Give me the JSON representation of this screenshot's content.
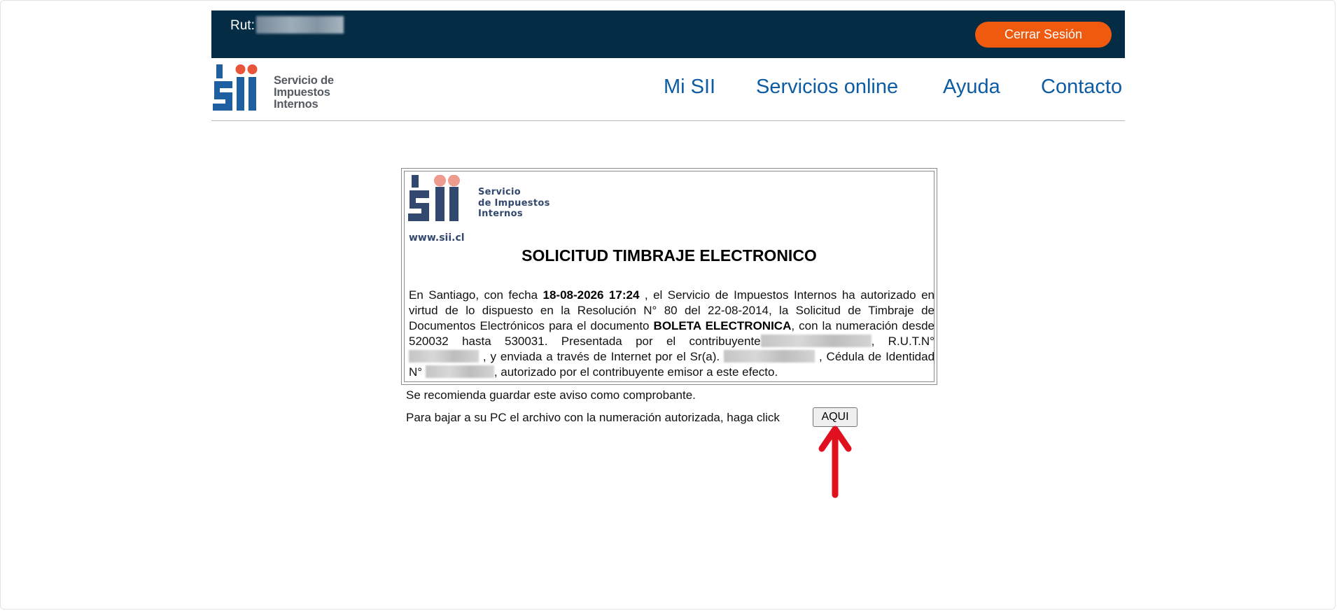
{
  "topbar": {
    "rut_label": "Rut:",
    "logout_label": "Cerrar Sesión"
  },
  "header": {
    "logo_lines": [
      "Servicio de",
      "Impuestos",
      "Internos"
    ],
    "nav": [
      {
        "label": "Mi SII"
      },
      {
        "label": "Servicios online"
      },
      {
        "label": "Ayuda"
      },
      {
        "label": "Contacto"
      }
    ]
  },
  "certificate": {
    "logo_lines": [
      "Servicio",
      "de Impuestos",
      "Internos"
    ],
    "url": "www.sii.cl",
    "title": "SOLICITUD TIMBRAJE ELECTRONICO",
    "body": {
      "p1": "En Santiago, con fecha",
      "fecha": "18-08-2026 17:24",
      "p2": ", el Servicio de Impuestos Internos ha autorizado en virtud de lo dispuesto en la Resolución N° 80 del 22-08-2014, la Solicitud de Timbraje de Documentos Electrónicos para el documento",
      "documento": "BOLETA ELECTRONICA",
      "p3": ", con la numeración desde 520032 hasta 530031. Presentada por el contribuyente",
      "p4": ", R.U.T.N°",
      "p5": ", y enviada a través de Internet por el Sr(a).",
      "p6": ", Cédula de Identidad N°",
      "p7": ", autorizado por el contribuyente emisor a este efecto."
    }
  },
  "notes": {
    "save_notice": "Se recomienda guardar este aviso como comprobante.",
    "download_prompt": "Para bajar a su PC el archivo con la numeración autorizada, haga click",
    "download_button": "AQUI"
  },
  "colors": {
    "topbar": "#042c45",
    "logout_button": "#ef5a0e",
    "nav_link": "#0d5ca3",
    "logo_blue": "#1d5fa0",
    "logo_dot": "#e8553a",
    "annotation_arrow": "#e0101e"
  }
}
